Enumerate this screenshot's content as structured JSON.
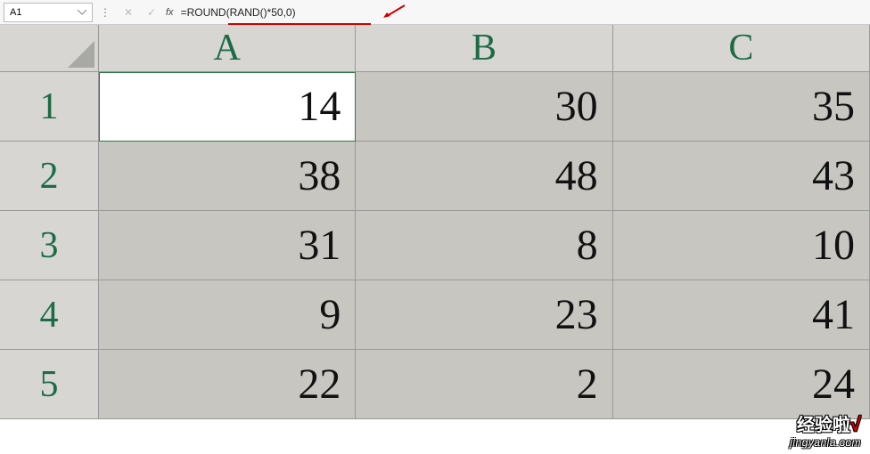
{
  "formula_bar": {
    "cell_ref": "A1",
    "formula": "=ROUND(RAND()*50,0)",
    "fx_label": "fx"
  },
  "columns": [
    "A",
    "B",
    "C"
  ],
  "rows": [
    "1",
    "2",
    "3",
    "4",
    "5"
  ],
  "cells": [
    [
      "14",
      "30",
      "35"
    ],
    [
      "38",
      "48",
      "43"
    ],
    [
      "31",
      "8",
      "10"
    ],
    [
      "9",
      "23",
      "41"
    ],
    [
      "22",
      "2",
      "24"
    ]
  ],
  "active_cell": "A1",
  "watermark": {
    "line1": "经验啦",
    "check": "√",
    "line2": "jingyanla.com"
  }
}
